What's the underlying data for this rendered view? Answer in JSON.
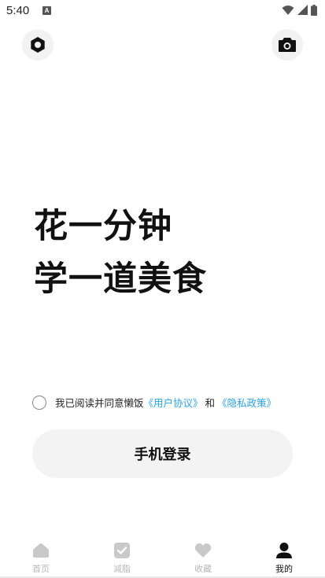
{
  "status_bar": {
    "time": "5:40",
    "a_icon_text": "A",
    "icons": [
      "wifi-icon",
      "signal-icon",
      "battery-icon"
    ]
  },
  "top_buttons": {
    "left_icon": "settings-icon",
    "right_icon": "camera-icon"
  },
  "headline": {
    "line1": "花一分钟",
    "line2": "学一道美食"
  },
  "agreement": {
    "text": "我已阅读并同意懒饭",
    "user_agreement": "《用户协议》",
    "and": "和",
    "privacy_policy": "《隐私政策》"
  },
  "login_button": "手机登录",
  "tabs": [
    {
      "label": "首页",
      "icon": "home-icon",
      "active": false
    },
    {
      "label": "减脂",
      "icon": "shield-check-icon",
      "active": false
    },
    {
      "label": "收藏",
      "icon": "heart-icon",
      "active": false
    },
    {
      "label": "我的",
      "icon": "person-icon",
      "active": true
    }
  ],
  "colors": {
    "link": "#2aa3e6",
    "inactive_tab": "#b8b8b8",
    "active_tab": "#111111",
    "button_bg": "#f3f3f3"
  }
}
